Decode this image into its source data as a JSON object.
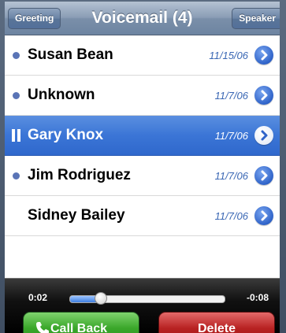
{
  "navbar": {
    "title": "Voicemail (4)",
    "left_button": "Greeting",
    "right_button": "Speaker"
  },
  "voicemails": [
    {
      "name": "Susan Bean",
      "date": "11/15/06",
      "status": "unheard"
    },
    {
      "name": "Unknown",
      "date": "11/7/06",
      "status": "unheard"
    },
    {
      "name": "Gary Knox",
      "date": "11/7/06",
      "status": "playing"
    },
    {
      "name": "Jim Rodriguez",
      "date": "11/7/06",
      "status": "unheard"
    },
    {
      "name": "Sidney Bailey",
      "date": "11/7/06",
      "status": "heard"
    }
  ],
  "player": {
    "elapsed": "0:02",
    "remaining": "-0:08",
    "progress": 0.2,
    "call_back_label": "Call Back",
    "delete_label": "Delete"
  },
  "colors": {
    "accent": "#3b75d6",
    "unread_dot": "#5a74b6",
    "call_back": "#3aa72a",
    "delete": "#b82222"
  },
  "icons": {
    "unread": "dot-icon",
    "playing": "pause-icon",
    "detail": "chevron-right-icon",
    "call": "phone-icon"
  }
}
